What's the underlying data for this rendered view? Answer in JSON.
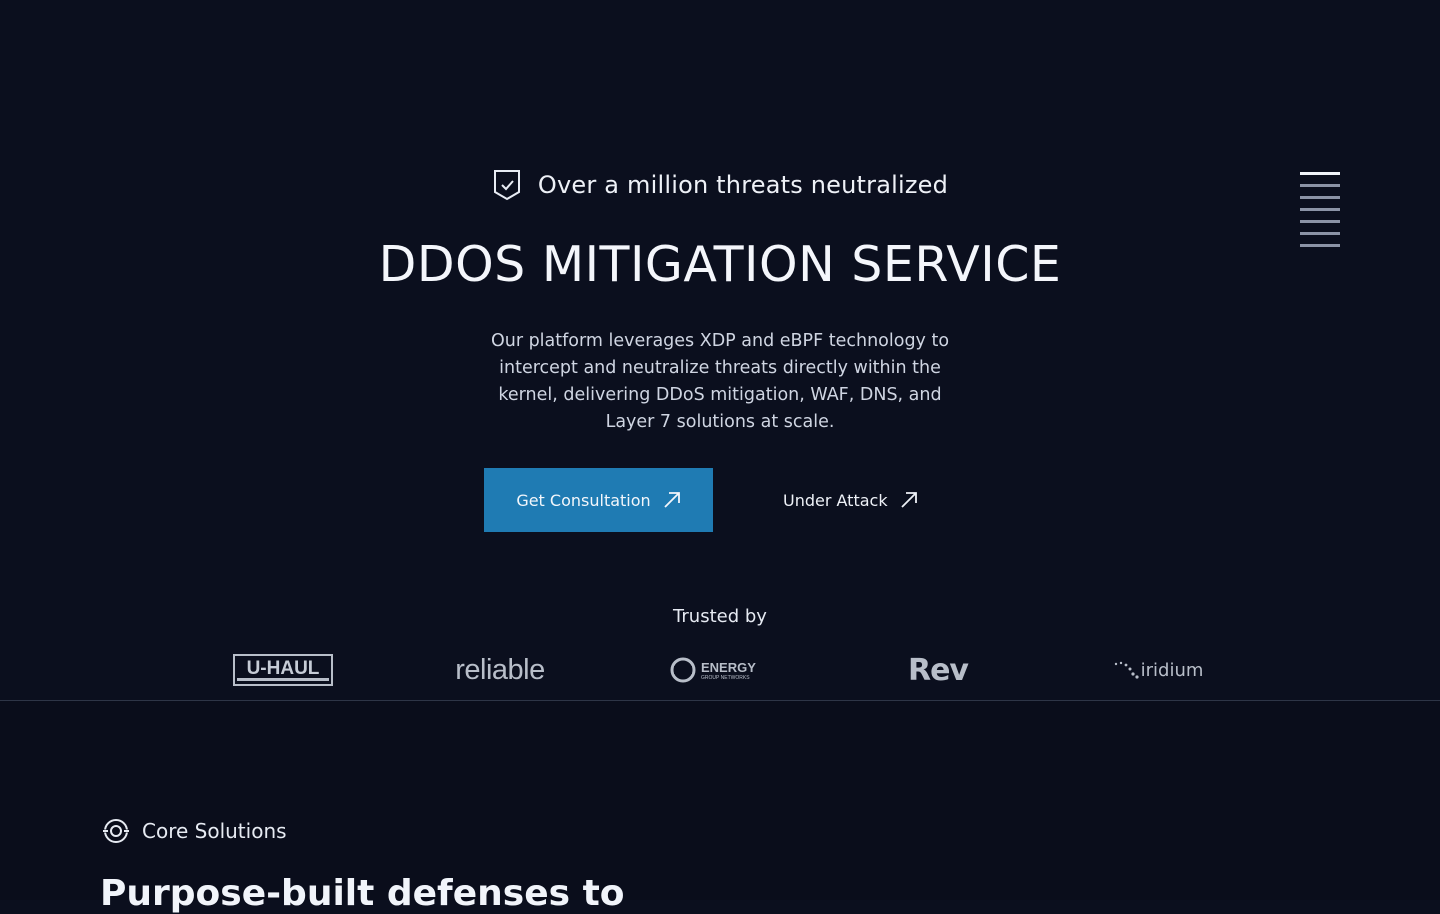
{
  "hero": {
    "badge_text": "Over a million threats neutralized",
    "title": "DDOS MITIGATION SERVICE",
    "description": "Our platform leverages XDP and eBPF technology to intercept and neutralize threats directly within the kernel, delivering DDoS mitigation, WAF, DNS, and Layer 7 solutions at scale.",
    "primary_cta": "Get Consultation",
    "secondary_cta": "Under Attack"
  },
  "menu": {
    "icon": "hamburger-menu-icon"
  },
  "trusted": {
    "label": "Trusted by",
    "logos": [
      "U-HAUL",
      "reliable",
      "ENERGY",
      "GROUP NETWORKS",
      "Rev",
      "iridium"
    ]
  },
  "solutions": {
    "label": "Core Solutions",
    "heading": "Purpose-built defenses to"
  },
  "colors": {
    "background": "#0b0f1e",
    "primary_button": "#1f7bb3",
    "text": "#e8ecf4"
  }
}
